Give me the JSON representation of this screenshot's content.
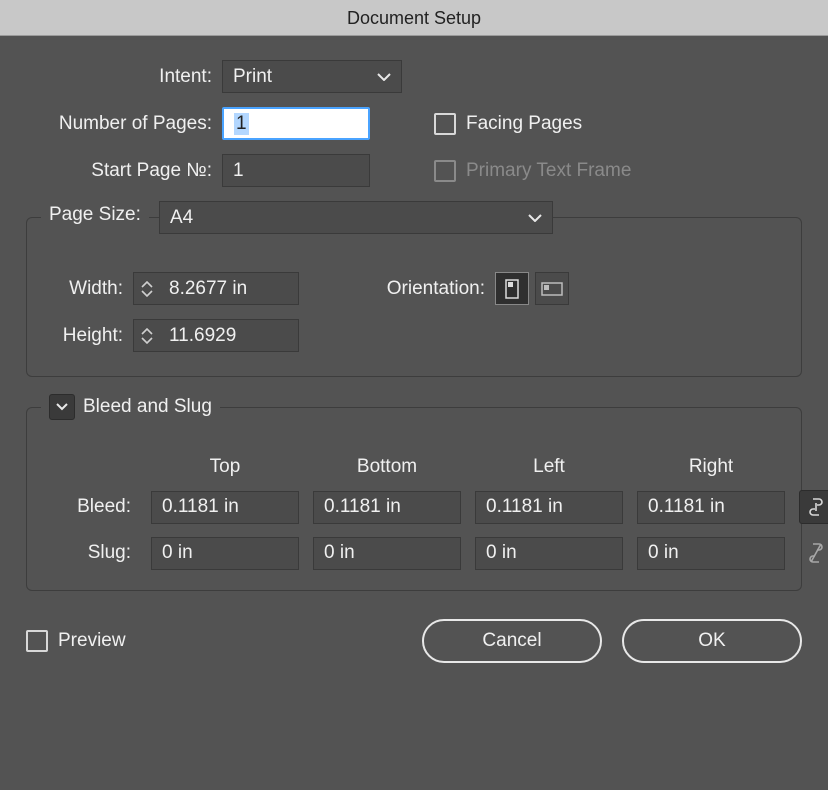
{
  "title": "Document Setup",
  "intent": {
    "label": "Intent:",
    "value": "Print"
  },
  "numPages": {
    "label": "Number of Pages:",
    "value": "1"
  },
  "startPage": {
    "label": "Start Page №:",
    "value": "1"
  },
  "facingPages": {
    "label": "Facing Pages",
    "checked": false
  },
  "primaryTextFrame": {
    "label": "Primary Text Frame",
    "checked": false,
    "disabled": true
  },
  "pageSize": {
    "label": "Page Size:",
    "value": "A4"
  },
  "width": {
    "label": "Width:",
    "value": "8.2677 in"
  },
  "height": {
    "label": "Height:",
    "value": "11.6929"
  },
  "orientation": {
    "label": "Orientation:",
    "value": "portrait"
  },
  "bleedSlug": {
    "sectionLabel": "Bleed and Slug",
    "headers": {
      "top": "Top",
      "bottom": "Bottom",
      "left": "Left",
      "right": "Right"
    },
    "bleedLabel": "Bleed:",
    "slugLabel": "Slug:",
    "bleed": {
      "top": "0.1181 in",
      "bottom": "0.1181 in",
      "left": "0.1181 in",
      "right": "0.1181 in",
      "linked": true
    },
    "slug": {
      "top": "0 in",
      "bottom": "0 in",
      "left": "0 in",
      "right": "0 in",
      "linked": false
    }
  },
  "preview": {
    "label": "Preview",
    "checked": false
  },
  "buttons": {
    "cancel": "Cancel",
    "ok": "OK"
  }
}
